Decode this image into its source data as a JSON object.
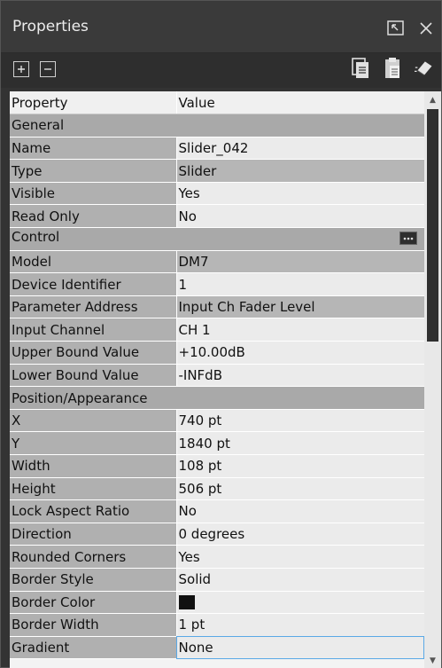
{
  "window": {
    "title": "Properties"
  },
  "grid": {
    "col_property": "Property",
    "col_value": "Value",
    "rows": [
      {
        "kind": "cat",
        "label": "General"
      },
      {
        "kind": "prop",
        "name": "Name",
        "value": "Slider_042"
      },
      {
        "kind": "prop",
        "name": "Type",
        "value": "Slider",
        "alt": true
      },
      {
        "kind": "prop",
        "name": "Visible",
        "value": "Yes"
      },
      {
        "kind": "prop",
        "name": "Read Only",
        "value": "No"
      },
      {
        "kind": "cat",
        "label": "Control",
        "icon": "ellipsis-icon"
      },
      {
        "kind": "prop",
        "name": "Model",
        "value": "DM7",
        "alt": true
      },
      {
        "kind": "prop",
        "name": "Device Identifier",
        "value": "1"
      },
      {
        "kind": "prop",
        "name": "Parameter Address",
        "value": "Input Ch Fader Level",
        "alt": true
      },
      {
        "kind": "prop",
        "name": "Input Channel",
        "value": "CH 1"
      },
      {
        "kind": "prop",
        "name": "Upper Bound Value",
        "value": "+10.00dB"
      },
      {
        "kind": "prop",
        "name": "Lower Bound Value",
        "value": "-INFdB"
      },
      {
        "kind": "cat",
        "label": "Position/Appearance"
      },
      {
        "kind": "prop",
        "name": "X",
        "value": "740 pt"
      },
      {
        "kind": "prop",
        "name": "Y",
        "value": "1840 pt"
      },
      {
        "kind": "prop",
        "name": "Width",
        "value": "108 pt"
      },
      {
        "kind": "prop",
        "name": "Height",
        "value": "506 pt"
      },
      {
        "kind": "prop",
        "name": "Lock Aspect Ratio",
        "value": "No"
      },
      {
        "kind": "prop",
        "name": "Direction",
        "value": "0 degrees"
      },
      {
        "kind": "prop",
        "name": "Rounded Corners",
        "value": "Yes"
      },
      {
        "kind": "prop",
        "name": "Border Style",
        "value": "Solid"
      },
      {
        "kind": "prop",
        "name": "Border Color",
        "value": "",
        "swatch": "#111111"
      },
      {
        "kind": "prop",
        "name": "Border Width",
        "value": "1 pt"
      },
      {
        "kind": "prop",
        "name": "Gradient",
        "value": "None",
        "selected": true
      }
    ]
  },
  "icons": {
    "float": "restore-window-icon",
    "close": "close-icon",
    "expand": "expand-all-icon",
    "collapse": "collapse-all-icon",
    "copy": "copy-icon",
    "paste": "paste-icon",
    "clear": "eraser-icon"
  }
}
